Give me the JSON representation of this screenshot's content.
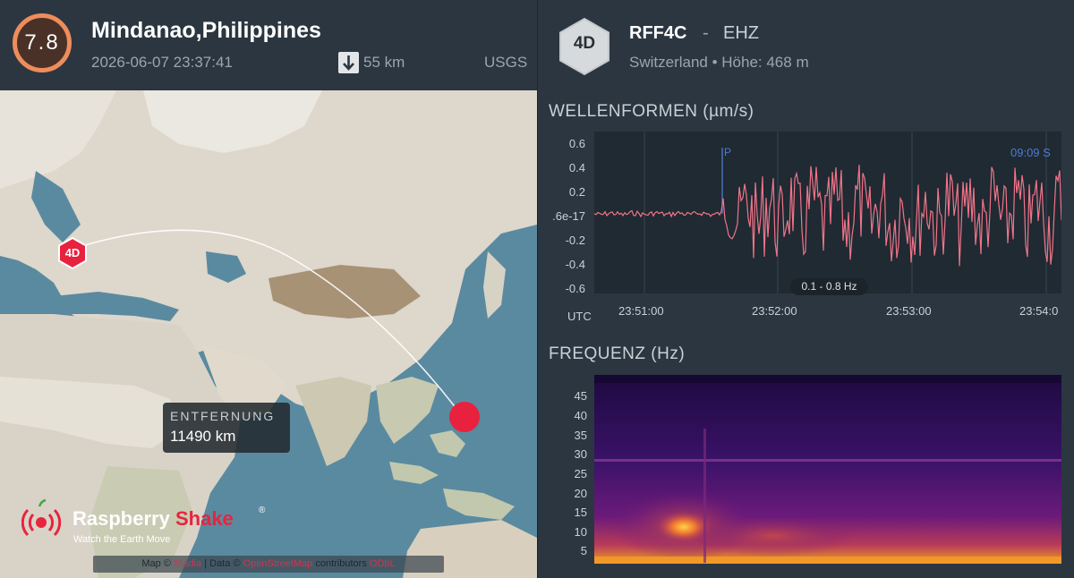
{
  "event": {
    "magnitude": "7.8",
    "location": "Mindanao,Philippines",
    "datetime": "2026-06-07 23:37:41",
    "depth": "55 km",
    "source": "USGS",
    "magnitude_color": "#ee8d5c"
  },
  "map": {
    "station_marker": "4D",
    "distance_label": "ENTFERNUNG",
    "distance_value": "11490 km",
    "logo": {
      "part1": "Raspberry",
      "part2": "Shake",
      "reg": "®",
      "tagline": "Watch the Earth Move"
    },
    "attribution": {
      "prefix": "Map ©",
      "link1": "Stadia",
      "mid": "| Data ©",
      "link2": "OpenStreetMap",
      "suffix": "contributors",
      "link3": "ODbL"
    },
    "event_color": "#e8213f"
  },
  "station": {
    "badge": "4D",
    "code": "RFF4C",
    "separator": "-",
    "channel": "EHZ",
    "location_line": "Switzerland • Höhe: 468 m"
  },
  "waveform": {
    "title": "WELLENFORMEN (µm/s)",
    "y_ticks": [
      "0.6",
      "0.4",
      "0.2",
      ".6e-17",
      "-0.2",
      "-0.4",
      "-0.6"
    ],
    "x_ticks": [
      "23:51:00",
      "23:52:00",
      "23:53:00",
      "23:54:0"
    ],
    "utc_label": "UTC",
    "p_label": "P",
    "clock": "09:09  S",
    "filter": "0.1 - 0.8 Hz",
    "trace_color": "#f07488"
  },
  "spectrogram": {
    "title": "FREQUENZ (Hz)",
    "y_ticks": [
      "45",
      "40",
      "35",
      "30",
      "25",
      "20",
      "15",
      "10",
      "5"
    ]
  }
}
